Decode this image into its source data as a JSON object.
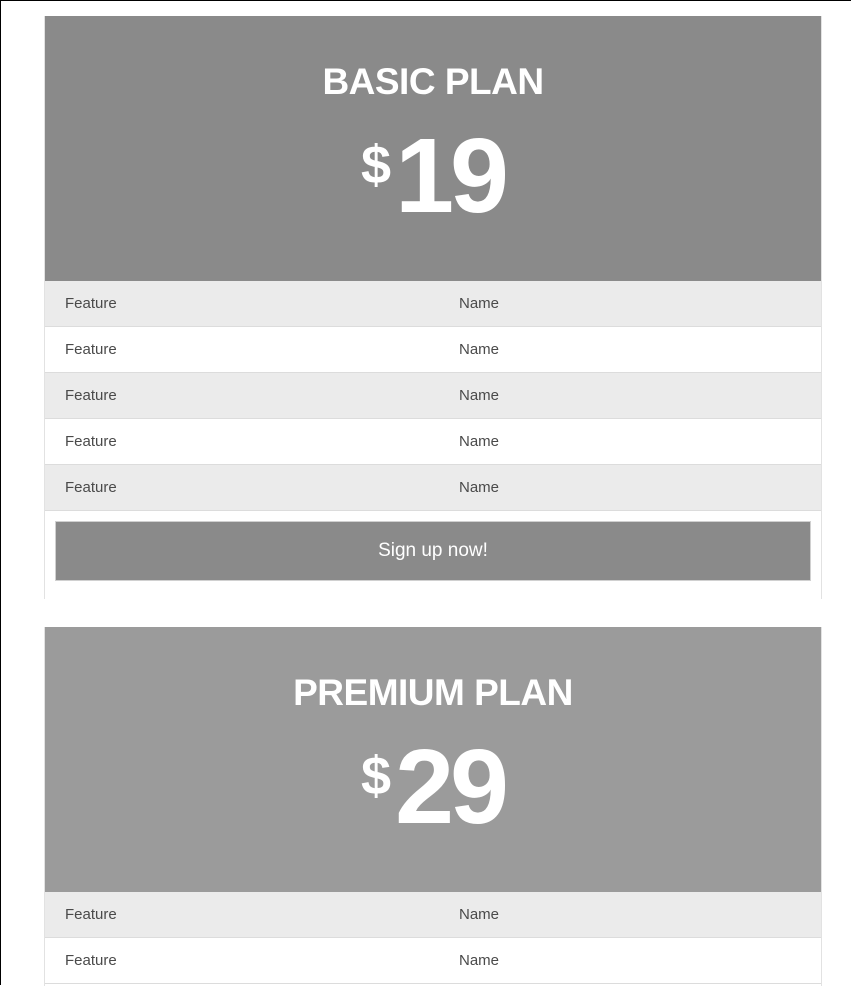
{
  "plans": [
    {
      "title": "BASIC PLAN",
      "currency": "$",
      "amount": "19",
      "features": [
        {
          "label": "Feature",
          "value": "Name"
        },
        {
          "label": "Feature",
          "value": "Name"
        },
        {
          "label": "Feature",
          "value": "Name"
        },
        {
          "label": "Feature",
          "value": "Name"
        },
        {
          "label": "Feature",
          "value": "Name"
        }
      ],
      "button_label": "Sign up now!"
    },
    {
      "title": "PREMIUM PLAN",
      "currency": "$",
      "amount": "29",
      "features": [
        {
          "label": "Feature",
          "value": "Name"
        },
        {
          "label": "Feature",
          "value": "Name"
        }
      ]
    }
  ],
  "colors": {
    "basic_header": "#8a8a8a",
    "premium_header": "#9b9b9b",
    "row_shaded": "#ebebeb",
    "row_plain": "#ffffff",
    "button": "#8a8a8a"
  }
}
